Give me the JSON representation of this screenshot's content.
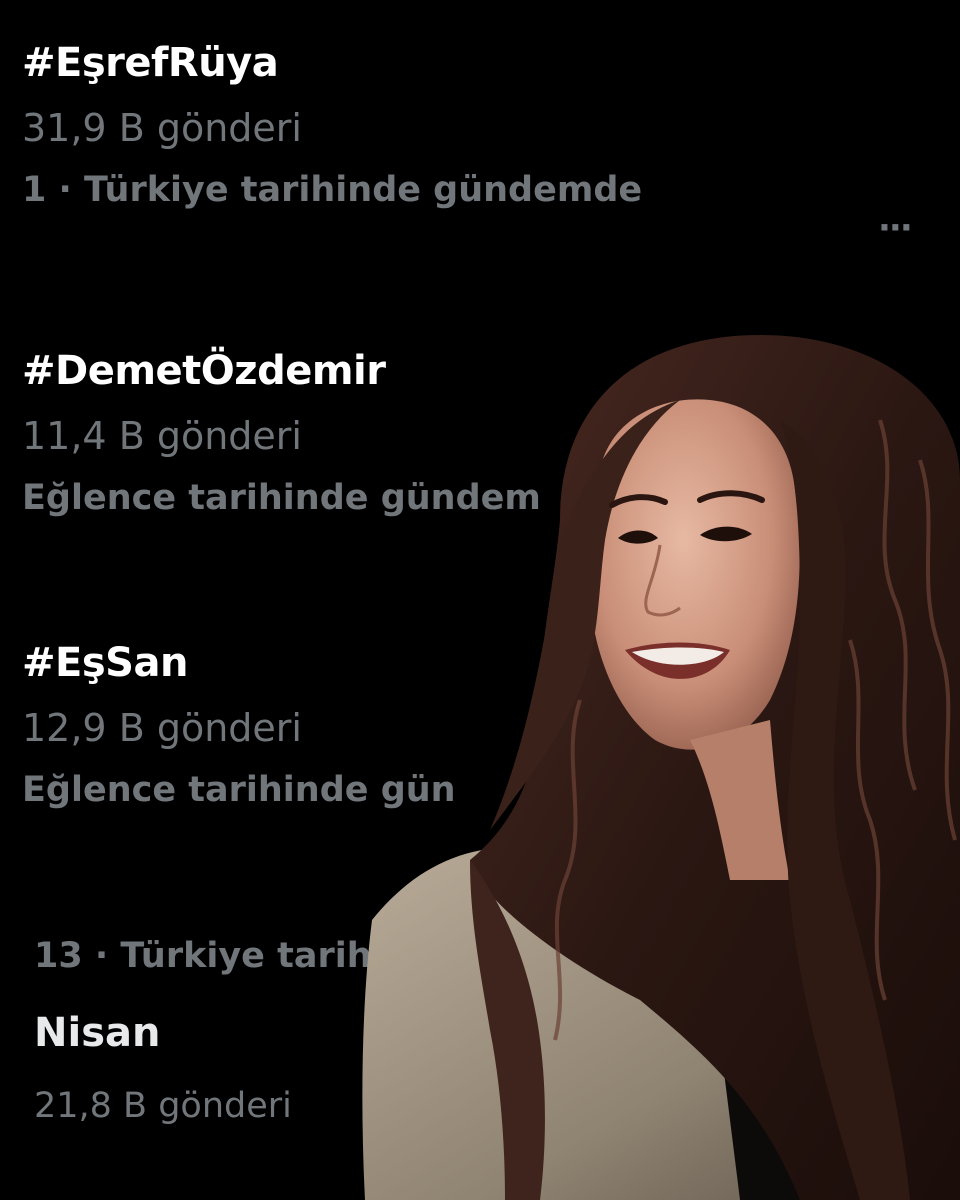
{
  "trends": [
    {
      "tag": "#EşrefRüya",
      "count": "31,9 B gönderi",
      "context": "1 · Türkiye tarihinde gündemde"
    },
    {
      "tag": "#DemetÖzdemir",
      "count": "11,4 B gönderi",
      "context": "Eğlence tarihinde gündem"
    },
    {
      "tag": "#EşSan",
      "count": "12,9 B gönderi",
      "context": "Eğlence tarihinde gün"
    }
  ],
  "more_icon": "ellipsis-icon",
  "more_label": "···",
  "secondary_trend": {
    "context": "13 · Türkiye tarih",
    "name": "Nisan",
    "count": "21,8 B gönderi"
  },
  "colors": {
    "background": "#000000",
    "primary_text": "#ffffff",
    "secondary_text": "#71767b"
  }
}
